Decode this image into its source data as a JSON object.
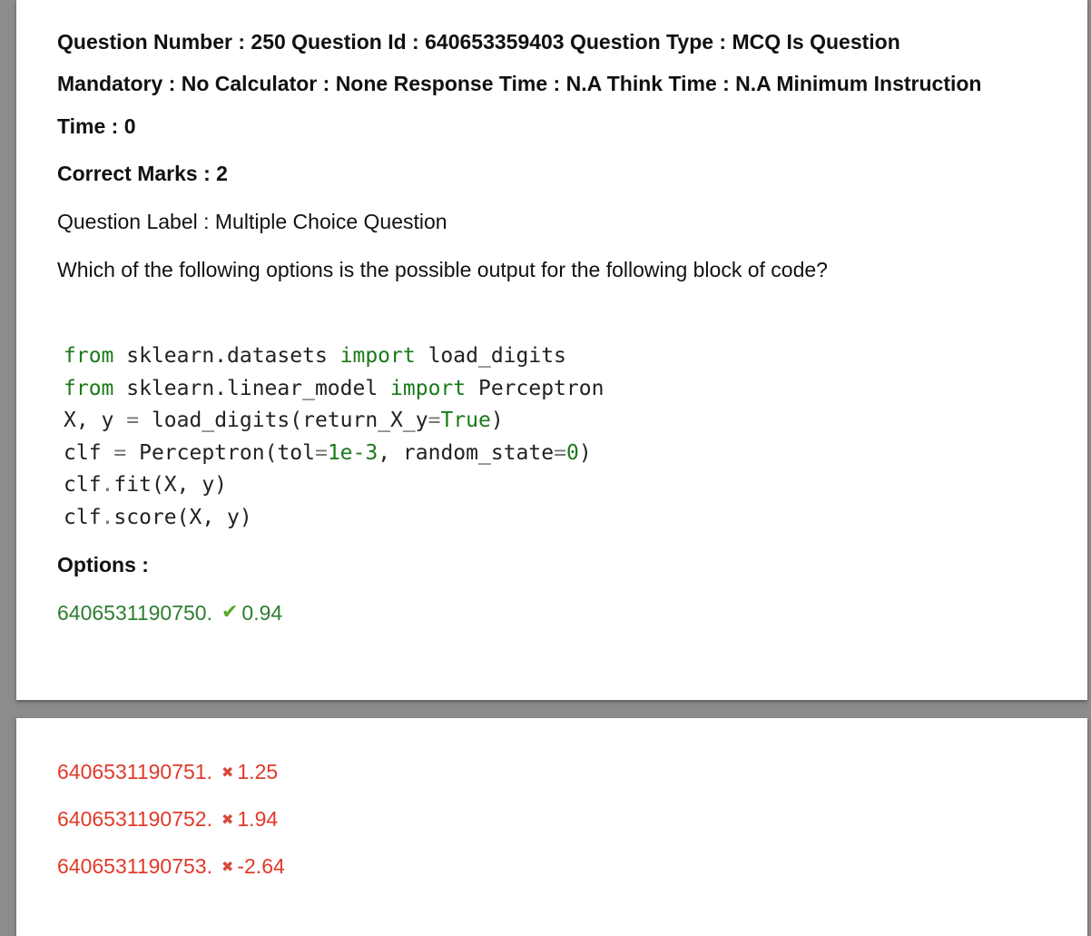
{
  "header": {
    "line1": "Question Number : 250 Question Id : 640653359403 Question Type : MCQ Is Question",
    "line2": "Mandatory : No Calculator : None Response Time : N.A Think Time : N.A Minimum Instruction",
    "line3": "Time : 0"
  },
  "correct_marks": "Correct Marks : 2",
  "question_label": "Question Label : Multiple Choice Question",
  "question_text": "Which of the following options is the possible output for the following block of code?",
  "code": {
    "l1": {
      "kw1": "from",
      "mod": " sklearn.datasets ",
      "kw2": "import",
      "rest": " load_digits"
    },
    "l2": {
      "kw1": "from",
      "mod": " sklearn.linear_model ",
      "kw2": "import",
      "rest": " Perceptron"
    },
    "l3": {
      "a": "X, y ",
      "eq": "=",
      "b": " load_digits(return_X_y",
      "eq2": "=",
      "c": "True",
      "d": ")"
    },
    "l4": {
      "a": "clf ",
      "eq": "=",
      "b": " Perceptron(tol",
      "eq2": "=",
      "c": "1e-3",
      "d": ", random_state",
      "eq3": "=",
      "e": "0",
      "f": ")"
    },
    "l5": {
      "a": "clf",
      "dot": ".",
      "b": "fit(X, y)"
    },
    "l6": {
      "a": "clf",
      "dot": ".",
      "b": "score(X, y)"
    }
  },
  "options_label": "Options :",
  "options": [
    {
      "id": "6406531190750.",
      "value": "0.94",
      "correct": true,
      "icon": "check-icon"
    },
    {
      "id": "6406531190751.",
      "value": "1.25",
      "correct": false,
      "icon": "cross-icon"
    },
    {
      "id": "6406531190752.",
      "value": "1.94",
      "correct": false,
      "icon": "cross-icon"
    },
    {
      "id": "6406531190753.",
      "value": "-2.64",
      "correct": false,
      "icon": "cross-icon"
    }
  ],
  "colors": {
    "correct": "#2e7d32",
    "wrong": "#e03a2a",
    "background": "#8c8c8c"
  }
}
